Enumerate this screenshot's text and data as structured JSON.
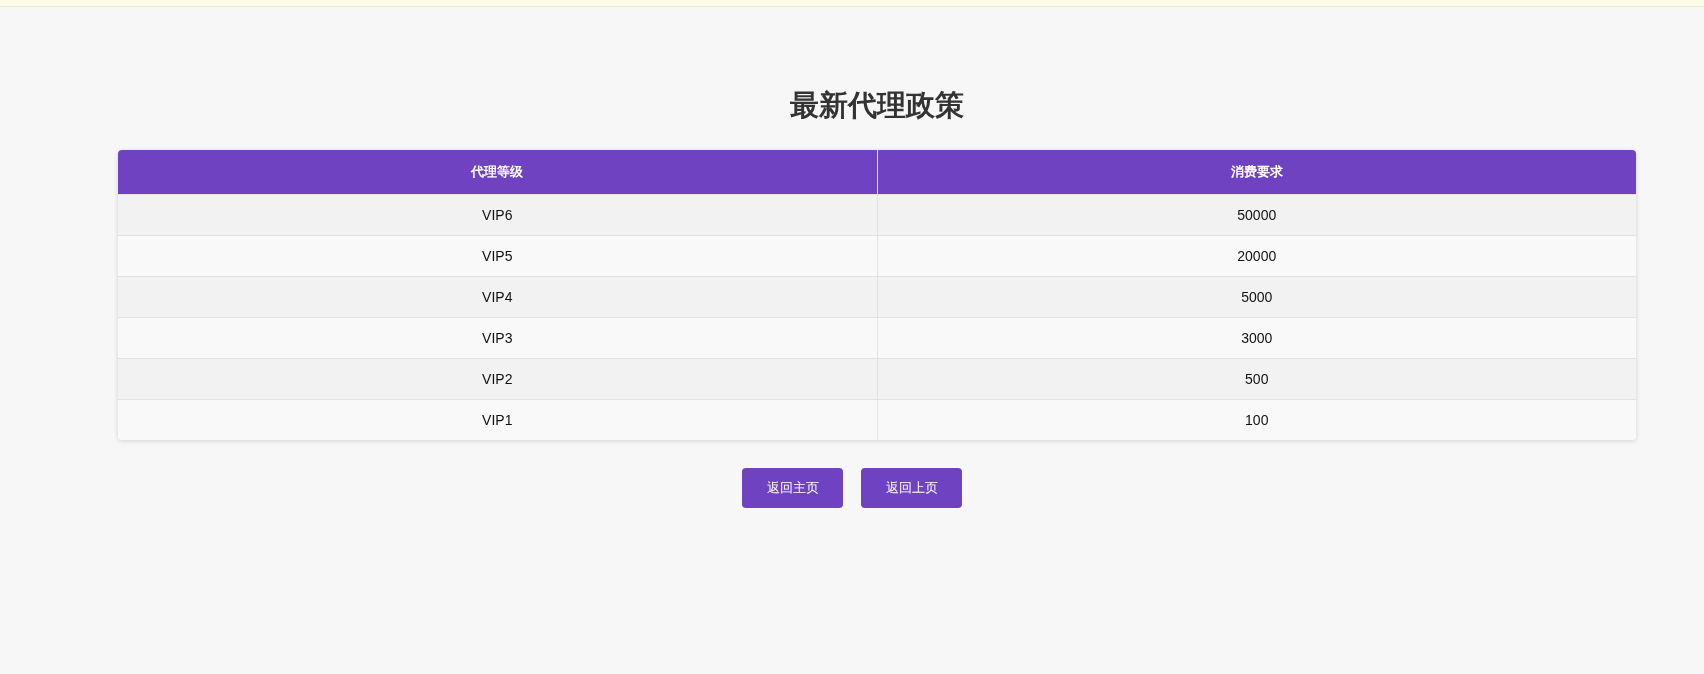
{
  "title": "最新代理政策",
  "table": {
    "columns": [
      "代理等级",
      "消费要求"
    ],
    "rows": [
      [
        "VIP6",
        "50000"
      ],
      [
        "VIP5",
        "20000"
      ],
      [
        "VIP4",
        "5000"
      ],
      [
        "VIP3",
        "3000"
      ],
      [
        "VIP2",
        "500"
      ],
      [
        "VIP1",
        "100"
      ]
    ]
  },
  "buttons": [
    "返回主页",
    "返回上页"
  ]
}
